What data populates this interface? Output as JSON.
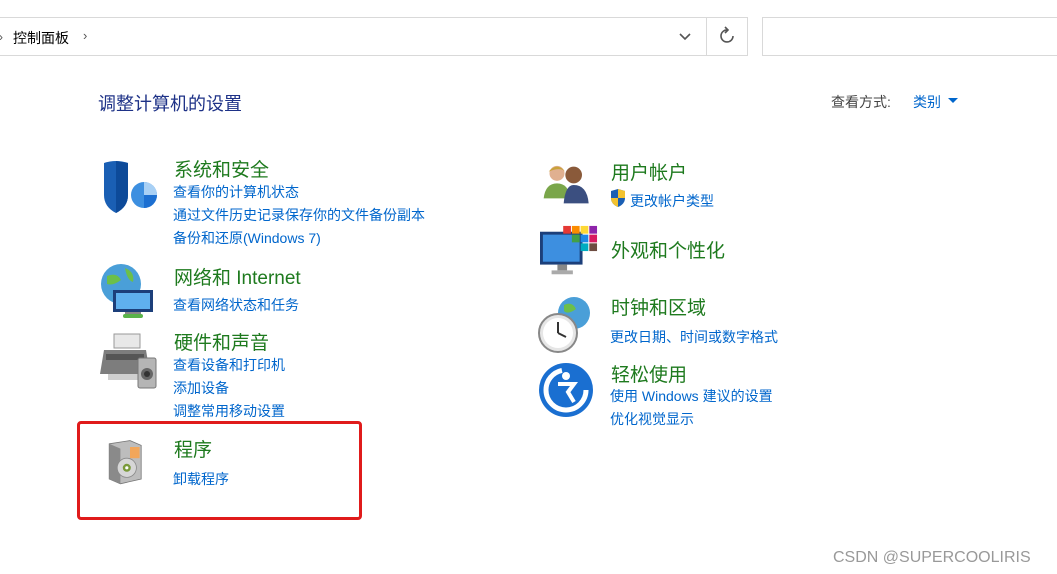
{
  "address": {
    "breadcrumb": "控制面板",
    "chevron": "›",
    "refresh_glyph": "↻"
  },
  "header": {
    "title": "调整计算机的设置",
    "view_label": "查看方式:",
    "view_value": "类别"
  },
  "left_categories": [
    {
      "title": "系统和安全",
      "icon": "shield-icon",
      "links": [
        "查看你的计算机状态",
        "通过文件历史记录保存你的文件备份副本",
        "备份和还原(Windows 7)"
      ]
    },
    {
      "title": "网络和 Internet",
      "icon": "network-globe-icon",
      "links": [
        "查看网络状态和任务"
      ]
    },
    {
      "title": "硬件和声音",
      "icon": "printer-speaker-icon",
      "links": [
        "查看设备和打印机",
        "添加设备",
        "调整常用移动设置"
      ]
    },
    {
      "title": "程序",
      "icon": "programs-disc-icon",
      "links": [
        "卸载程序"
      ]
    }
  ],
  "right_categories": [
    {
      "title": "用户帐户",
      "icon": "users-icon",
      "links": [
        "更改帐户类型"
      ]
    },
    {
      "title": "外观和个性化",
      "icon": "monitor-palette-icon",
      "links": []
    },
    {
      "title": "时钟和区域",
      "icon": "clock-globe-icon",
      "links": [
        "更改日期、时间或数字格式"
      ]
    },
    {
      "title": "轻松使用",
      "icon": "ease-of-access-icon",
      "links": [
        "使用 Windows 建议的设置",
        "优化视觉显示"
      ]
    }
  ],
  "colors": {
    "title_green": "#1e7a1e",
    "link_blue": "#0066cc",
    "header_blue": "#1e3287",
    "highlight_red": "#e01b1b"
  },
  "watermark": "CSDN @SUPERCOOLIRIS"
}
